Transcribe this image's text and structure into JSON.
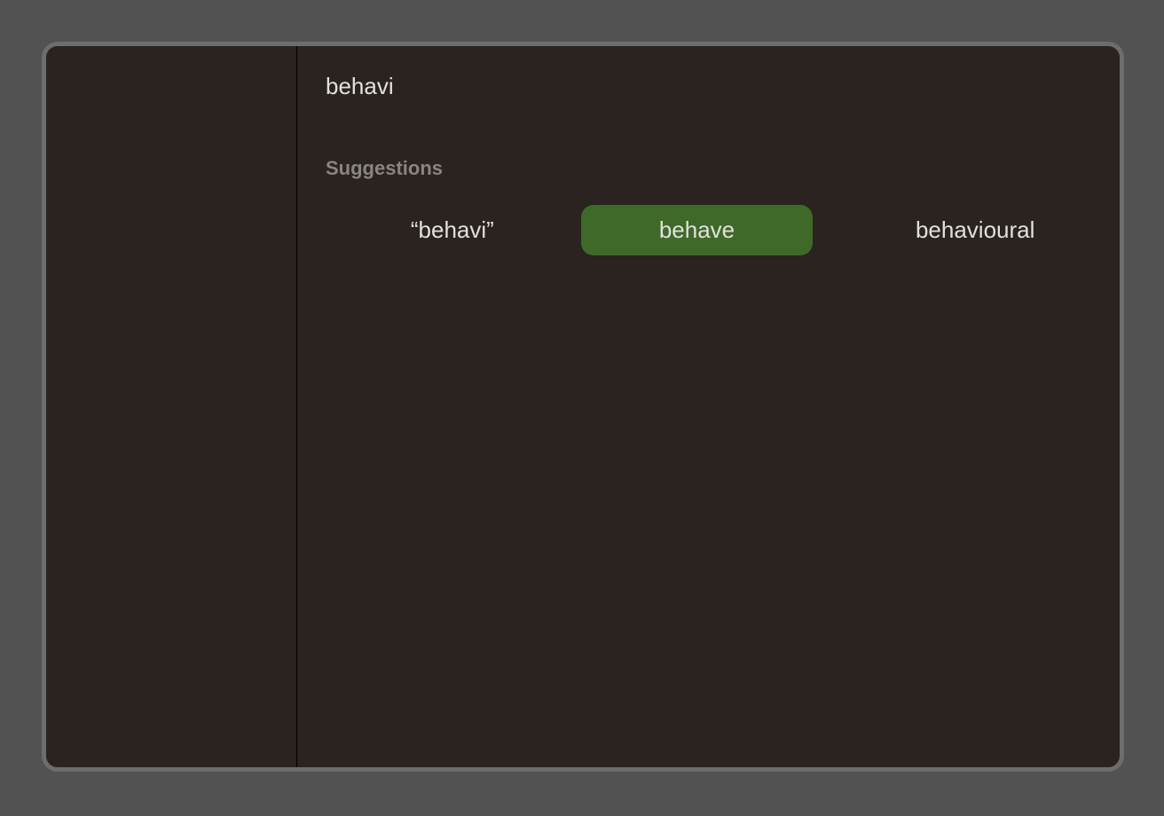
{
  "search": {
    "value": "behavi"
  },
  "suggestions": {
    "label": "Suggestions",
    "items": [
      {
        "label": "“behavi”",
        "selected": false
      },
      {
        "label": "behave",
        "selected": true
      },
      {
        "label": "behavioural",
        "selected": false
      }
    ]
  }
}
